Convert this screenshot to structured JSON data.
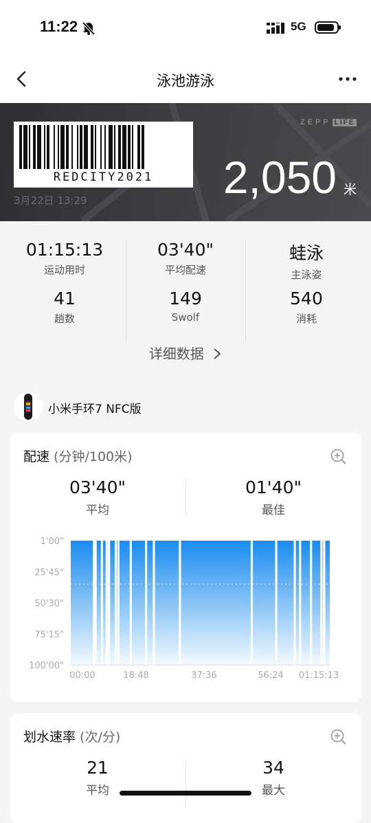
{
  "status_bar": {
    "time": "11:22",
    "network": "5G",
    "icons": [
      "bell-slash-icon",
      "signal-icon",
      "battery-icon"
    ]
  },
  "nav": {
    "title": "泳池游泳",
    "back_icon": "chevron-left-icon",
    "more_icon": "more-dots-icon"
  },
  "banner": {
    "barcode_text": "REDCITY2021",
    "date": "3月22日 13:29",
    "brand_left": "ZEPP",
    "brand_right": "LIFE",
    "distance": "2,050",
    "distance_unit": "米"
  },
  "stats": {
    "items": [
      {
        "value": "01:15:13",
        "label": "运动用时"
      },
      {
        "value": "03'40\"",
        "label": "平均配速"
      },
      {
        "value": "蛙泳",
        "label": "主泳姿"
      },
      {
        "value": "41",
        "label": "趟数"
      },
      {
        "value": "149",
        "label": "Swolf"
      },
      {
        "value": "540",
        "label": "消耗"
      }
    ],
    "detail_link": "详细数据"
  },
  "device": {
    "name": "小米手环7 NFC版"
  },
  "pace_card": {
    "title": "配速",
    "unit": " (分钟/100米)",
    "avg_value": "03'40\"",
    "avg_label": "平均",
    "best_value": "01'40\"",
    "best_label": "最佳"
  },
  "stroke_card": {
    "title": "划水速率",
    "unit": " (次/分)",
    "avg_value": "21",
    "avg_label": "平均",
    "max_value": "34",
    "max_label": "最大"
  },
  "chart_data": {
    "type": "area",
    "ytick_labels": [
      "1'00\"",
      "25'45\"",
      "50'30\"",
      "75'15\"",
      "100'00\""
    ],
    "xtick_labels": [
      "00:00",
      "18:48",
      "37:36",
      "56:24",
      "01:15:13"
    ],
    "y_axis_inverted": true,
    "x_range_seconds": [
      0,
      4513
    ],
    "avg_line_label": "平均",
    "gaps_seconds": [
      403,
      433,
      543,
      626,
      667,
      784,
      830,
      1046,
      1312,
      1448,
      1902,
      3154,
      3580,
      3903,
      3996,
      4186,
      4368,
      4415
    ],
    "color": "#1a8cf0"
  },
  "colors": {
    "accent": "#1a8cf0",
    "banner_bg": "#3d3d40"
  }
}
